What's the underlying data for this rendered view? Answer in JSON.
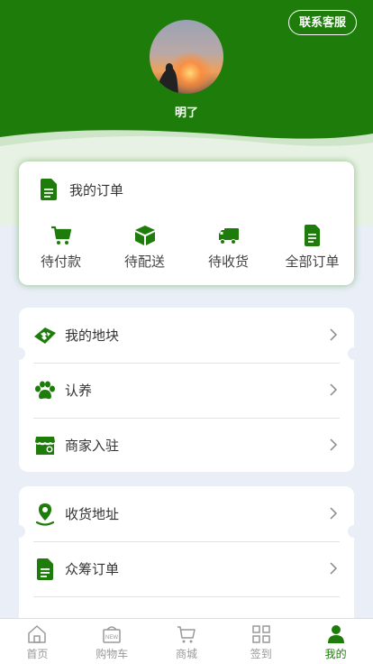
{
  "header": {
    "contact_label": "联系客服",
    "username": "明了"
  },
  "orders": {
    "title": "我的订单",
    "items": [
      {
        "label": "待付款",
        "icon": "cart-icon"
      },
      {
        "label": "待配送",
        "icon": "box-icon"
      },
      {
        "label": "待收货",
        "icon": "truck-icon"
      },
      {
        "label": "全部订单",
        "icon": "document-icon"
      }
    ]
  },
  "menu1": {
    "items": [
      {
        "label": "我的地块",
        "icon": "field-plot-icon"
      },
      {
        "label": "认养",
        "icon": "paw-icon"
      },
      {
        "label": "商家入驻",
        "icon": "store-icon"
      }
    ]
  },
  "menu2": {
    "items": [
      {
        "label": "收货地址",
        "icon": "location-pin-icon"
      },
      {
        "label": "众筹订单",
        "icon": "document-icon"
      }
    ]
  },
  "tabbar": {
    "items": [
      {
        "label": "首页",
        "icon": "home-icon"
      },
      {
        "label": "购物车",
        "icon": "new-basket-icon"
      },
      {
        "label": "商城",
        "icon": "shop-cart-icon"
      },
      {
        "label": "签到",
        "icon": "grid-icon"
      },
      {
        "label": "我的",
        "icon": "person-icon",
        "active": true
      }
    ]
  },
  "colors": {
    "brand_green": "#1e7c0a",
    "background": "#e9eef7",
    "inactive_tab": "#999999"
  }
}
